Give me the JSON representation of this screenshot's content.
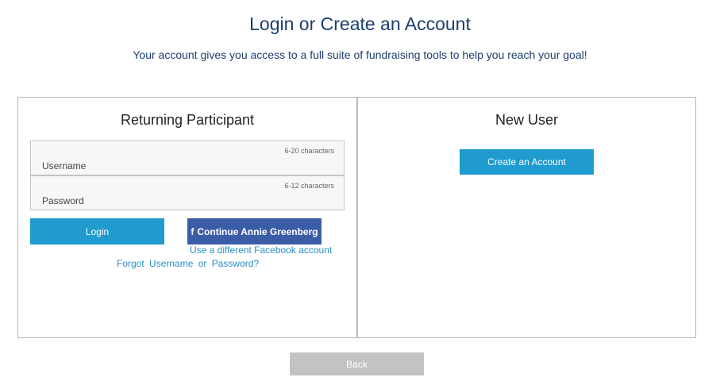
{
  "header": {
    "title": "Login or Create an Account",
    "subtitle": "Your account gives you access to a full suite of fundraising tools to help you reach your goal!"
  },
  "returning": {
    "heading": "Returning Participant",
    "username": {
      "placeholder": "Username",
      "hint": "6-20 characters",
      "value": ""
    },
    "password": {
      "placeholder": "Password",
      "hint": "6-12 characters",
      "value": ""
    },
    "login_label": "Login",
    "facebook": {
      "icon": "facebook-f-icon",
      "label": "Continue Annie Greenberg",
      "alt_link": "Use a different Facebook account"
    },
    "forgot": {
      "prefix": "Forgot",
      "username_link": "Username",
      "or": "or",
      "password_link": "Password?"
    }
  },
  "new_user": {
    "heading": "New User",
    "create_label": "Create an Account"
  },
  "footer": {
    "back_label": "Back"
  },
  "colors": {
    "title": "#1d3f6e",
    "primary_button": "#1f9bcf",
    "facebook_button": "#3b5da8",
    "link": "#2a8fc4",
    "back_button": "#c3c3c3",
    "border": "#b8b8b8"
  }
}
